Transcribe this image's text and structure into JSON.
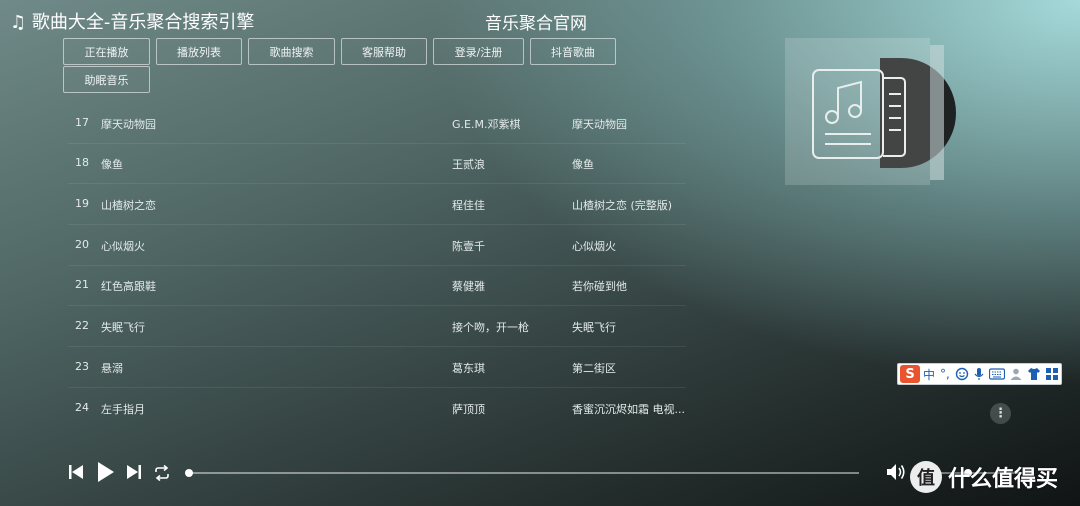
{
  "header": {
    "title": "♫ 歌曲大全-音乐聚合搜索引擎",
    "site_name": "音乐聚合官网"
  },
  "nav": [
    {
      "label": "正在播放"
    },
    {
      "label": "播放列表"
    },
    {
      "label": "歌曲搜索"
    },
    {
      "label": "客服帮助"
    },
    {
      "label": "登录/注册"
    },
    {
      "label": "抖音歌曲"
    },
    {
      "label": "助眠音乐"
    }
  ],
  "songs": [
    {
      "num": "17",
      "title": "摩天动物园",
      "artist": "G.E.M.邓紫棋",
      "album": "摩天动物园"
    },
    {
      "num": "18",
      "title": "像鱼",
      "artist": "王贰浪",
      "album": "像鱼"
    },
    {
      "num": "19",
      "title": "山楂树之恋",
      "artist": "程佳佳",
      "album": "山楂树之恋 (完整版)"
    },
    {
      "num": "20",
      "title": "心似烟火",
      "artist": "陈壹千",
      "album": "心似烟火"
    },
    {
      "num": "21",
      "title": "红色高跟鞋",
      "artist": "蔡健雅",
      "album": "若你碰到他"
    },
    {
      "num": "22",
      "title": "失眠飞行",
      "artist": "接个吻，开一枪",
      "album": "失眠飞行"
    },
    {
      "num": "23",
      "title": "悬溺",
      "artist": "葛东琪",
      "album": "第二街区"
    },
    {
      "num": "24",
      "title": "左手指月",
      "artist": "萨顶顶",
      "album": "香蜜沉沉烬如霜 电视..."
    }
  ],
  "ime_toolbar": {
    "logo": "S",
    "mode": "中",
    "punct": "°,"
  },
  "player": {
    "progress": 0.0,
    "volume": 0.35
  },
  "watermark": {
    "symbol": "值",
    "text": "什么值得买"
  },
  "colors": {
    "ime_logo": "#e8542e",
    "ime_icons": "#1e5fb3",
    "text": "#e3eaea"
  }
}
